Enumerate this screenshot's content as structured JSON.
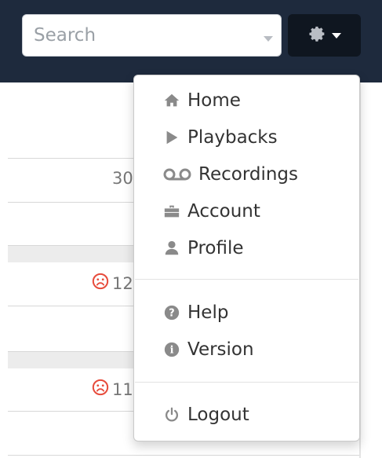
{
  "navbar": {
    "search": {
      "placeholder": "Search",
      "value": ""
    },
    "settings_button": {
      "icon": "gear-icon",
      "caret": "caret-down-icon"
    }
  },
  "table": {
    "cells": [
      {
        "text": "30",
        "icon": null
      },
      {
        "text": "12",
        "icon": "sad-face-icon"
      },
      {
        "text": "11",
        "icon": "sad-face-icon"
      }
    ],
    "status_color": "#e74c3c"
  },
  "menu": {
    "items": [
      {
        "label": "Home",
        "icon": "home-icon"
      },
      {
        "label": "Playbacks",
        "icon": "play-icon"
      },
      {
        "label": "Recordings",
        "icon": "voicemail-icon"
      },
      {
        "label": "Account",
        "icon": "briefcase-icon"
      },
      {
        "label": "Profile",
        "icon": "user-icon"
      },
      {
        "label": "Help",
        "icon": "question-circle-icon"
      },
      {
        "label": "Version",
        "icon": "info-circle-icon"
      },
      {
        "label": "Logout",
        "icon": "power-icon"
      }
    ]
  },
  "colors": {
    "navbar_bg": "#1e2a3d",
    "button_bg": "#0f1620",
    "icon_gray": "#8a8a8a"
  }
}
